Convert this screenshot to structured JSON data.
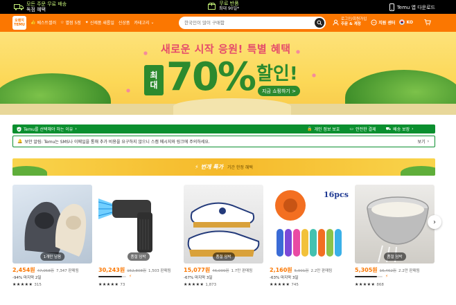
{
  "topbar": {
    "shipping_line1": "모든 주문 무료 배송",
    "shipping_line2": "독점 혜택",
    "returns_line1": "무료 반품",
    "returns_line2": "최대 90일*",
    "app_download": "Temu 앱 다운로드"
  },
  "header": {
    "logo_line1": "오렌지",
    "logo_line2": "TEMU",
    "nav": [
      "베스트셀러",
      "별점 5점",
      "신제품 새롭일",
      "신상품",
      "카테고리"
    ],
    "search_placeholder": "한국인이 많이 구매함",
    "login_line1": "로그인/회원가입",
    "login_line2": "주문 & 계정",
    "support": "지원 센터",
    "lang": "KO"
  },
  "banner": {
    "headline": "새로운 시작 응원! 특별 혜택",
    "badge_top": "최",
    "badge_bottom": "대",
    "percent": "70%",
    "discount_word": "할인!",
    "cta": "지금 쇼핑하기 >"
  },
  "trust": {
    "why": "Temu를 선택해야 하는 이유",
    "privacy": "개인 정보 보호",
    "payment": "안전한 결제",
    "delivery": "배송 보장"
  },
  "notice": {
    "text": "보안 알림: Temu는 SMS나 이메일을 통해 추가 비용을 요구하지 않으니 스캠 메시지와 링크에 주의하세요.",
    "view": "보기"
  },
  "deals": {
    "title": "번개 특가",
    "subtitle": "기간 한정 혜택"
  },
  "products": [
    {
      "tag": "1개만 남음",
      "price": "2,454원",
      "orig": "47,058원",
      "sold": "7,347 판매됨",
      "meta": "-94% 마지막 2일",
      "progress": null,
      "rating_count": "315"
    },
    {
      "tag": "품절 임박",
      "price": "30,243원",
      "orig": "152,808원",
      "sold": "1,503 판매됨",
      "meta": "",
      "progress": 0.85,
      "rating_count": "73"
    },
    {
      "tag": "품절 임박",
      "price": "15,077원",
      "orig": "46,099원",
      "sold": "1.7만 판매됨",
      "meta": "-67% 마지막 3일",
      "progress": null,
      "rating_count": "1,873"
    },
    {
      "tag": "",
      "price": "2,160원",
      "orig": "5,901원",
      "sold": "2.2만 판매됨",
      "meta": "-63% 마지막 3일",
      "progress": null,
      "rating_count": "745"
    },
    {
      "tag": "품절 임박",
      "price": "5,305원",
      "orig": "16,462원",
      "sold": "2.2만 판매됨",
      "meta": "",
      "progress": 0.8,
      "rating_count": "868"
    }
  ],
  "stars": "★★★★★",
  "colors": {
    "brand": "#fb7701",
    "trust_green": "#0a8f2f",
    "banner_green": "#2c8a2e"
  }
}
